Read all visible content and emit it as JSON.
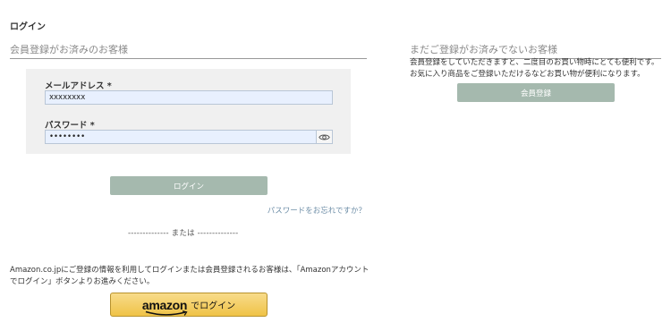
{
  "page_title": "ログイン",
  "member": {
    "heading": "会員登録がお済みのお客様",
    "email_label": "メールアドレス *",
    "email_value": "xxxxxxxx",
    "password_label": "パスワード *",
    "password_value": "••••••••",
    "login_button": "ログイン",
    "forgot_link": "パスワードをお忘れですか？",
    "or_divider": "-------------- または --------------"
  },
  "guest": {
    "heading": "まだご登録がお済みでないお客様",
    "text_line1": "会員登録をしていただきますと、二度目のお買い物時にとても便利です。",
    "text_line2": "お気に入り商品をご登録いただけるなどお買い物が便利になります。",
    "register_button": "会員登録"
  },
  "amazon": {
    "description_line1": "Amazon.co.jpにご登録の情報を利用してログインまたは会員登録されるお客様は、「Amazonアカウント",
    "description_line2": "でログイン」ボタンよりお進みください。",
    "button_logo": "amazon",
    "button_suffix": "でログイン"
  },
  "icons": {
    "password_toggle": "eye-icon",
    "amazon_smile": "amazon-smile-icon"
  },
  "colors": {
    "button_green": "#a5b9ae",
    "amazon_yellow": "#f0c14b",
    "link_blue": "#6f8fa8",
    "input_bg": "#e8f0fe"
  }
}
